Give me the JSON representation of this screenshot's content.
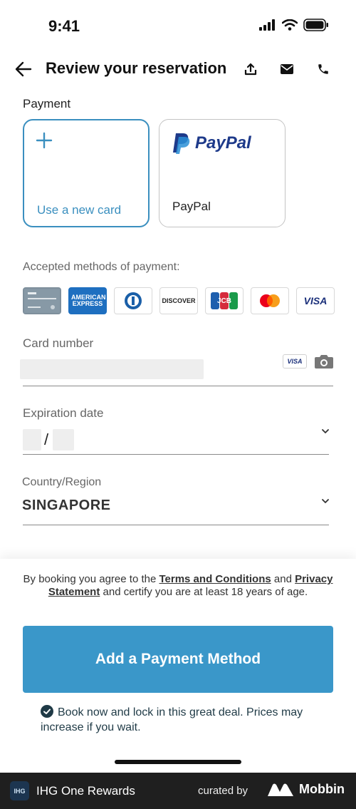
{
  "status_bar": {
    "time": "9:41"
  },
  "header": {
    "title": "Review your reservation"
  },
  "payment": {
    "section_label": "Payment",
    "new_card_label": "Use a new card",
    "paypal_logo_text": "PayPal",
    "paypal_label": "PayPal"
  },
  "accepted": {
    "label": "Accepted methods of payment:",
    "methods": [
      "AMERICAN EXPRESS",
      "DISCOVER",
      "JCB",
      "VISA"
    ]
  },
  "card_number": {
    "label": "Card number",
    "inline_badge": "VISA"
  },
  "expiration": {
    "label": "Expiration date",
    "separator": "/"
  },
  "country": {
    "label": "Country/Region",
    "value": "SINGAPORE"
  },
  "terms": {
    "prefix": "By booking you agree to the ",
    "terms_link": "Terms and Conditions",
    "middle": " and ",
    "privacy_link": "Privacy Statement",
    "suffix": " and certify you are at least 18 years of age."
  },
  "cta": {
    "label": "Add a Payment Method"
  },
  "deal": {
    "text": "Book now and lock in this great deal. Prices may increase if you wait."
  },
  "footer": {
    "logo_text": "IHG",
    "app_name": "IHG One Rewards",
    "curated_by": "curated by",
    "brand": "Mobbin"
  },
  "colors": {
    "accent": "#3a97c9",
    "new_card_border": "#3a8fbf",
    "paypal_blue": "#1e3a8a",
    "footer_bg": "#1f1f1f"
  }
}
